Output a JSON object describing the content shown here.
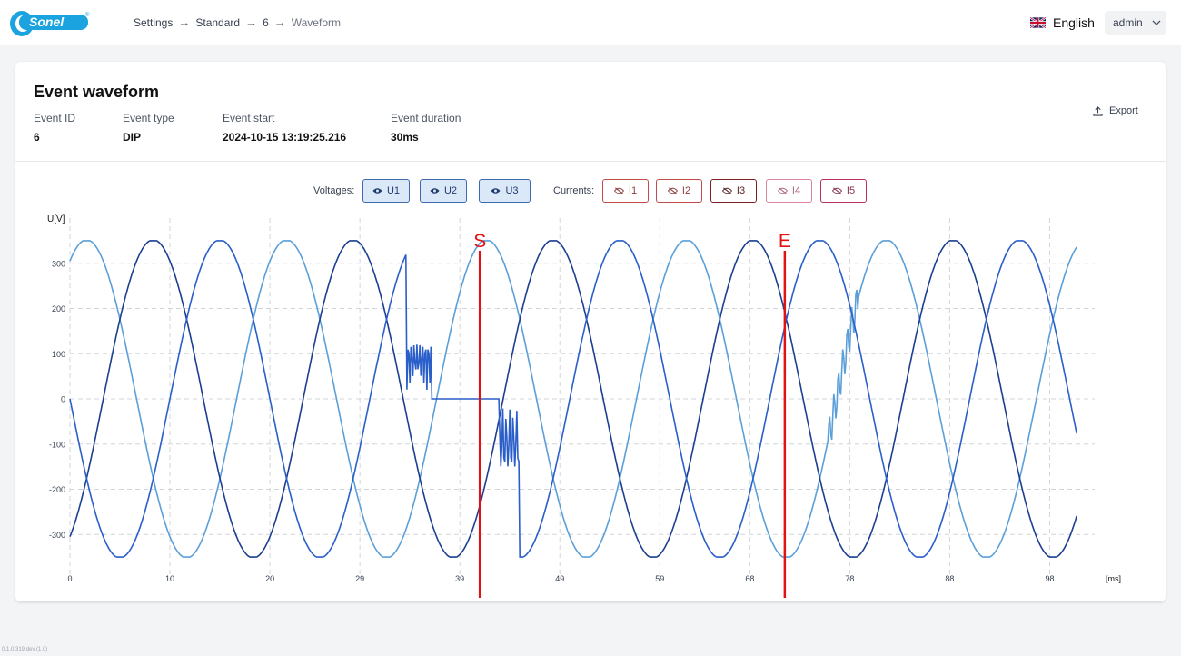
{
  "brand": {
    "logo_text": "Sonel"
  },
  "breadcrumb": [
    "Settings",
    "Standard",
    "6",
    "Waveform"
  ],
  "language": {
    "label": "English",
    "flag": "uk-flag-icon"
  },
  "user": {
    "name": "admin"
  },
  "event": {
    "title": "Event waveform",
    "export_label": "Export",
    "fields": [
      {
        "label": "Event ID",
        "value": "6"
      },
      {
        "label": "Event type",
        "value": "DIP"
      },
      {
        "label": "Event start",
        "value": "2024-10-15 13:19:25.216"
      },
      {
        "label": "Event duration",
        "value": "30ms"
      }
    ]
  },
  "toggles": {
    "voltages_label": "Voltages:",
    "currents_label": "Currents:",
    "voltages": [
      "U1",
      "U2",
      "U3"
    ],
    "currents": [
      "I1",
      "I2",
      "I3",
      "I4",
      "I5"
    ]
  },
  "chart_data": {
    "type": "line",
    "ylabel": "U[V]",
    "xunit": "[ms]",
    "xlim": [
      0,
      102.5
    ],
    "ylim": [
      -400,
      400
    ],
    "xticks": [
      "0",
      "10",
      "20",
      "29",
      "39",
      "49",
      "59",
      "68",
      "78",
      "88",
      "98"
    ],
    "yticks": [
      300,
      200,
      100,
      0,
      -100,
      -200,
      -300
    ],
    "markers": [
      {
        "label": "S",
        "x": 41
      },
      {
        "label": "E",
        "x": 71.5
      }
    ],
    "grid": true,
    "series": [
      {
        "color": "#5b9fd9",
        "amplitude": 352,
        "freq_hz": 50,
        "phase_deg": 60
      },
      {
        "color": "#1d3f91",
        "amplitude": 352,
        "freq_hz": 50,
        "phase_deg": -60
      },
      {
        "color": "#2a5ec8",
        "amplitude": 352,
        "freq_hz": 50,
        "phase_deg": 180
      }
    ],
    "event_window_ms": [
      33.7,
      45
    ]
  },
  "footer": {
    "version": "0.1.0.319.dev (1.0)"
  }
}
